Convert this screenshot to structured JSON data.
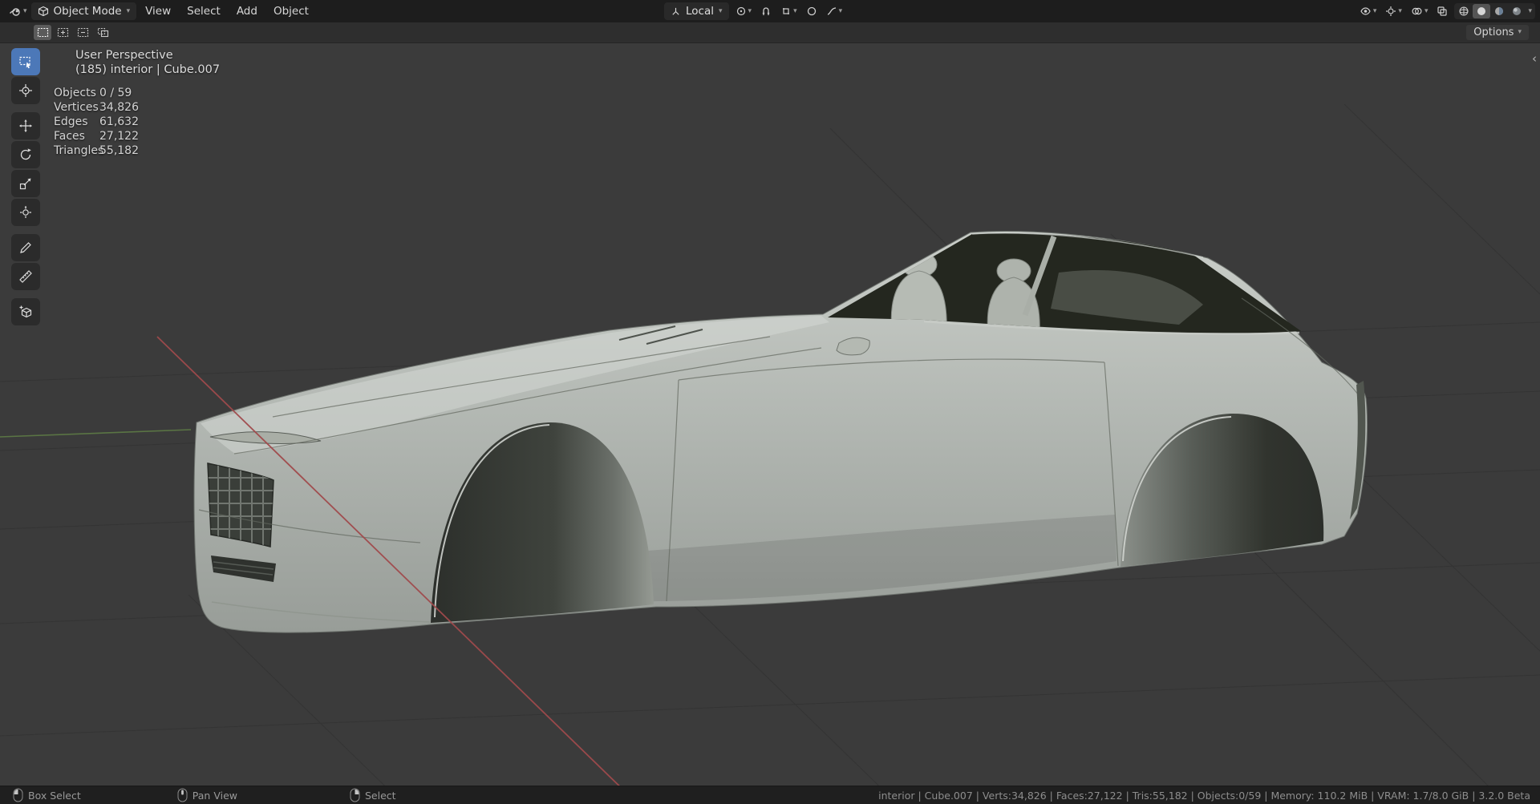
{
  "colors": {
    "accent": "#4c78b8",
    "axis_x": "#a04a4c",
    "axis_y": "#5e7c45",
    "viewport_bg": "#3b3b3b",
    "car_body_light": "#cacec9",
    "car_body_dark": "#989d98"
  },
  "topbar": {
    "mode_label": "Object Mode",
    "menus": [
      "View",
      "Select",
      "Add",
      "Object"
    ],
    "orientation_label": "Local",
    "options_label": "Options"
  },
  "viewport_overlay": {
    "title": "User Perspective",
    "subtitle": "(185) interior | Cube.007",
    "stats": [
      {
        "label": "Objects",
        "value": "0 / 59"
      },
      {
        "label": "Vertices",
        "value": "34,826"
      },
      {
        "label": "Edges",
        "value": "61,632"
      },
      {
        "label": "Faces",
        "value": "27,122"
      },
      {
        "label": "Triangles",
        "value": "55,182"
      }
    ]
  },
  "toolbar": {
    "tools": [
      "box-select",
      "cursor",
      "move",
      "rotate",
      "scale",
      "transform",
      "annotate",
      "measure",
      "add-cube"
    ],
    "active_tool": "box-select"
  },
  "statusbar": {
    "hints": [
      {
        "button": "left-mouse",
        "label": "Box Select"
      },
      {
        "button": "middle-mouse",
        "label": "Pan View"
      },
      {
        "button": "right-mouse",
        "label": "Select"
      }
    ],
    "info": "interior | Cube.007 | Verts:34,826 | Faces:27,122 | Tris:55,182 | Objects:0/59 | Memory: 110.2 MiB | VRAM: 1.7/8.0 GiB | 3.2.0 Beta"
  }
}
